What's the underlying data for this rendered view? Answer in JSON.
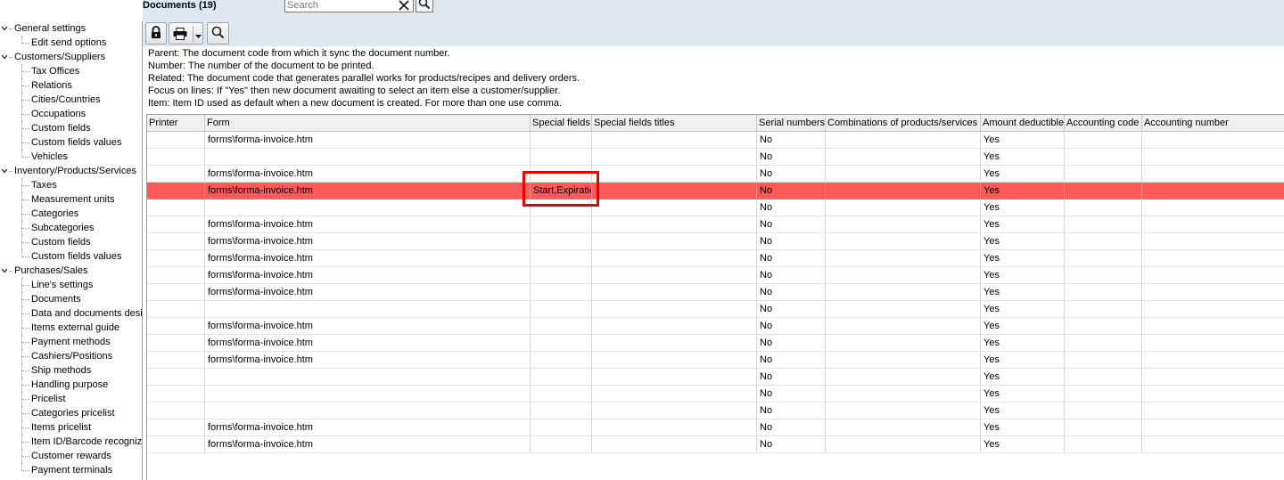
{
  "header": {
    "title": "Documents (19)",
    "search": {
      "placeholder": "Search",
      "value": ""
    }
  },
  "toolbar": {
    "buttons": [
      {
        "name": "lock",
        "icon": "lock-icon"
      },
      {
        "name": "print",
        "icon": "printer-icon"
      },
      {
        "name": "print-menu",
        "icon": "chevron-down-icon"
      },
      {
        "name": "find",
        "icon": "search-icon"
      }
    ]
  },
  "tree": {
    "groups": [
      {
        "label": "General settings",
        "items": [
          "Edit send options"
        ]
      },
      {
        "label": "Customers/Suppliers",
        "items": [
          "Tax Offices",
          "Relations",
          "Cities/Countries",
          "Occupations",
          "Custom fields",
          "Custom fields values",
          "Vehicles"
        ]
      },
      {
        "label": "Inventory/Products/Services",
        "items": [
          "Taxes",
          "Measurement units",
          "Categories",
          "Subcategories",
          "Custom fields",
          "Custom fields values"
        ]
      },
      {
        "label": "Purchases/Sales",
        "items": [
          "Line's settings",
          "Documents",
          "Data and documents design",
          "Items external guide",
          "Payment methods",
          "Cashiers/Positions",
          "Ship methods",
          "Handling purpose",
          "Pricelist",
          "Categories pricelist",
          "Items pricelist",
          "Item ID/Barcode recognize",
          "Customer rewards",
          "Payment terminals"
        ]
      }
    ]
  },
  "info": {
    "lines": [
      "Parent: The document code from which it sync the document number.",
      "Number: The number of the document to be printed.",
      "Related: The document code that generates parallel works for products/recipes and delivery orders.",
      "Focus on lines: If \"Yes\" then new document awaiting to select an item else a customer/supplier.",
      "Item: Item ID used as default when a new document is created. For more than one use comma."
    ]
  },
  "grid": {
    "columns": [
      "Printer",
      "Form",
      "Special fields",
      "Special fields titles",
      "Serial numbers",
      "Combinations of products/services",
      "Amount deductible",
      "Accounting code",
      "Accounting number"
    ],
    "selected_row": 3,
    "rows": [
      [
        "",
        "forms\\forma-invoice.htm",
        "",
        "",
        "No",
        "",
        "Yes",
        "",
        ""
      ],
      [
        "",
        "",
        "",
        "",
        "No",
        "",
        "Yes",
        "",
        ""
      ],
      [
        "",
        "forms\\forma-invoice.htm",
        "",
        "",
        "No",
        "",
        "Yes",
        "",
        ""
      ],
      [
        "",
        "forms\\forma-invoice.htm",
        "Start,Expiratic",
        "",
        "No",
        "",
        "Yes",
        "",
        ""
      ],
      [
        "",
        "",
        "",
        "",
        "No",
        "",
        "Yes",
        "",
        ""
      ],
      [
        "",
        "forms\\forma-invoice.htm",
        "",
        "",
        "No",
        "",
        "Yes",
        "",
        ""
      ],
      [
        "",
        "forms\\forma-invoice.htm",
        "",
        "",
        "No",
        "",
        "Yes",
        "",
        ""
      ],
      [
        "",
        "forms\\forma-invoice.htm",
        "",
        "",
        "No",
        "",
        "Yes",
        "",
        ""
      ],
      [
        "",
        "forms\\forma-invoice.htm",
        "",
        "",
        "No",
        "",
        "Yes",
        "",
        ""
      ],
      [
        "",
        "forms\\forma-invoice.htm",
        "",
        "",
        "No",
        "",
        "Yes",
        "",
        ""
      ],
      [
        "",
        "",
        "",
        "",
        "No",
        "",
        "Yes",
        "",
        ""
      ],
      [
        "",
        "forms\\forma-invoice.htm",
        "",
        "",
        "No",
        "",
        "Yes",
        "",
        ""
      ],
      [
        "",
        "forms\\forma-invoice.htm",
        "",
        "",
        "No",
        "",
        "Yes",
        "",
        ""
      ],
      [
        "",
        "forms\\forma-invoice.htm",
        "",
        "",
        "No",
        "",
        "Yes",
        "",
        ""
      ],
      [
        "",
        "",
        "",
        "",
        "No",
        "",
        "Yes",
        "",
        ""
      ],
      [
        "",
        "",
        "",
        "",
        "No",
        "",
        "Yes",
        "",
        ""
      ],
      [
        "",
        "",
        "",
        "",
        "No",
        "",
        "Yes",
        "",
        ""
      ],
      [
        "",
        "forms\\forma-invoice.htm",
        "",
        "",
        "No",
        "",
        "Yes",
        "",
        ""
      ],
      [
        "",
        "forms\\forma-invoice.htm",
        "",
        "",
        "No",
        "",
        "Yes",
        "",
        ""
      ]
    ]
  },
  "colors": {
    "selected_row": "#ff5a5a",
    "highlight_border": "#e00000",
    "toolbar_bg": "#dfe7ef"
  }
}
